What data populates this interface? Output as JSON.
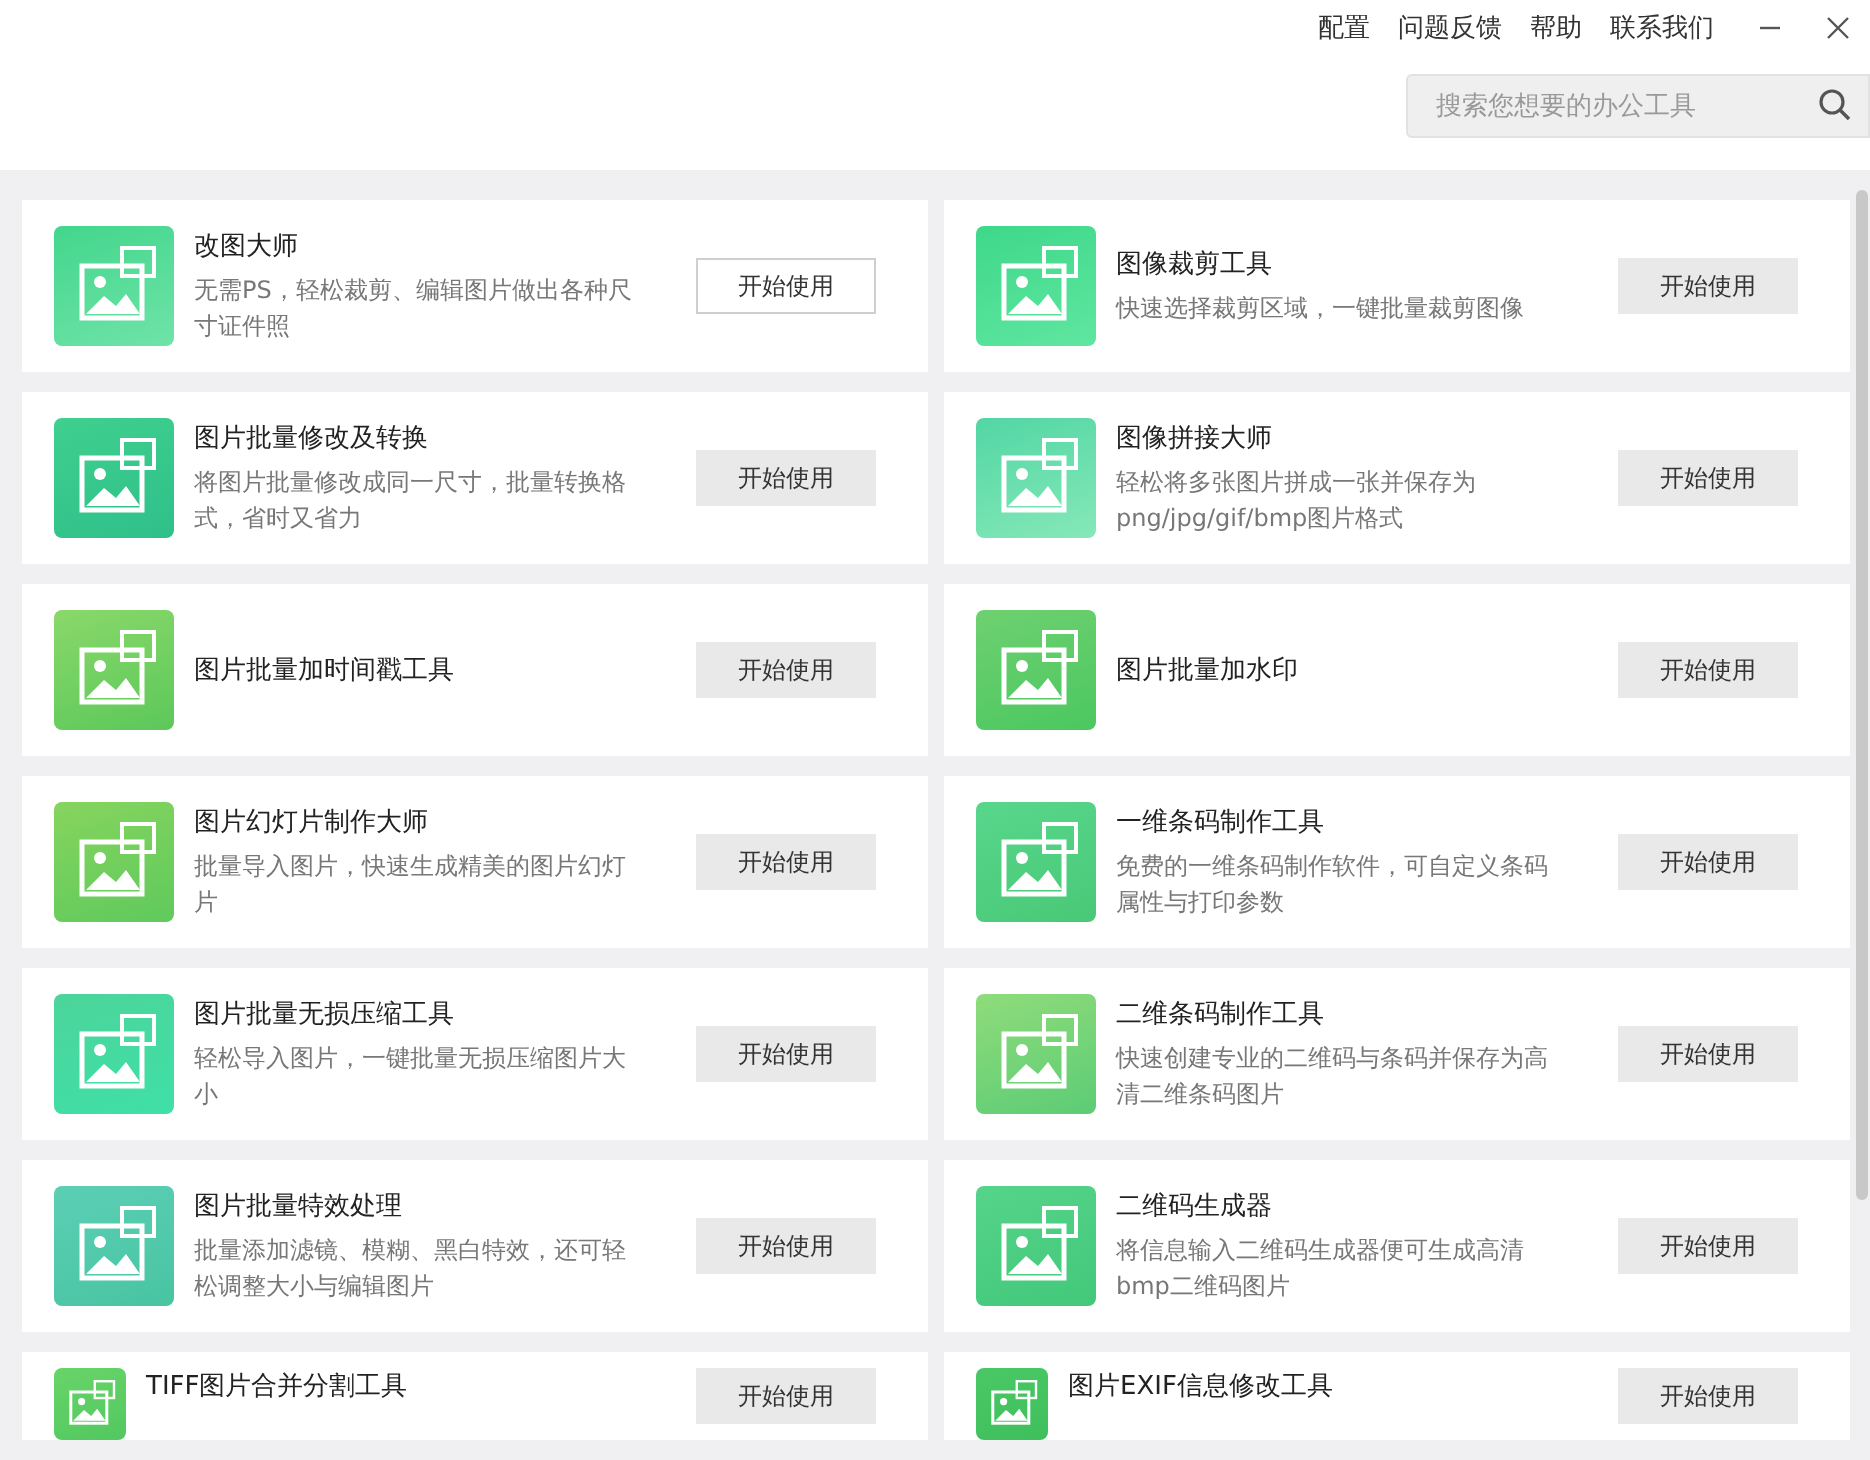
{
  "header": {
    "links": [
      "配置",
      "问题反馈",
      "帮助",
      "联系我们"
    ]
  },
  "search": {
    "placeholder": "搜索您想要的办公工具"
  },
  "tools": [
    {
      "title": "改图大师",
      "desc": "无需PS，轻松裁剪、编辑图片做出各种尺寸证件照",
      "button": "开始使用",
      "hovered": true
    },
    {
      "title": "图像裁剪工具",
      "desc": "快速选择裁剪区域，一键批量裁剪图像",
      "button": "开始使用",
      "hovered": false
    },
    {
      "title": "图片批量修改及转换",
      "desc": "将图片批量修改成同一尺寸，批量转换格式，省时又省力",
      "button": "开始使用",
      "hovered": false
    },
    {
      "title": "图像拼接大师",
      "desc": "轻松将多张图片拼成一张并保存为png/jpg/gif/bmp图片格式",
      "button": "开始使用",
      "hovered": false
    },
    {
      "title": "图片批量加时间戳工具",
      "button": "开始使用",
      "hovered": false
    },
    {
      "title": "图片批量加水印",
      "button": "开始使用",
      "hovered": false
    },
    {
      "title": "图片幻灯片制作大师",
      "desc": "批量导入图片，快速生成精美的图片幻灯片",
      "button": "开始使用",
      "hovered": false
    },
    {
      "title": "一维条码制作工具",
      "desc": "免费的一维条码制作软件，可自定义条码属性与打印参数",
      "button": "开始使用",
      "hovered": false
    },
    {
      "title": "图片批量无损压缩工具",
      "desc": "轻松导入图片，一键批量无损压缩图片大小",
      "button": "开始使用",
      "hovered": false
    },
    {
      "title": "二维条码制作工具",
      "desc": "快速创建专业的二维码与条码并保存为高清二维条码图片",
      "button": "开始使用",
      "hovered": false
    },
    {
      "title": "图片批量特效处理",
      "desc": "批量添加滤镜、模糊、黑白特效，还可轻松调整大小与编辑图片",
      "button": "开始使用",
      "hovered": false
    },
    {
      "title": "二维码生成器",
      "desc": "将信息输入二维码生成器便可生成高清bmp二维码图片",
      "button": "开始使用",
      "hovered": false
    },
    {
      "title": "TIFF图片合并分割工具",
      "button": "开始使用",
      "hovered": false
    },
    {
      "title": "图片EXIF信息修改工具",
      "button": "开始使用",
      "hovered": false
    }
  ]
}
